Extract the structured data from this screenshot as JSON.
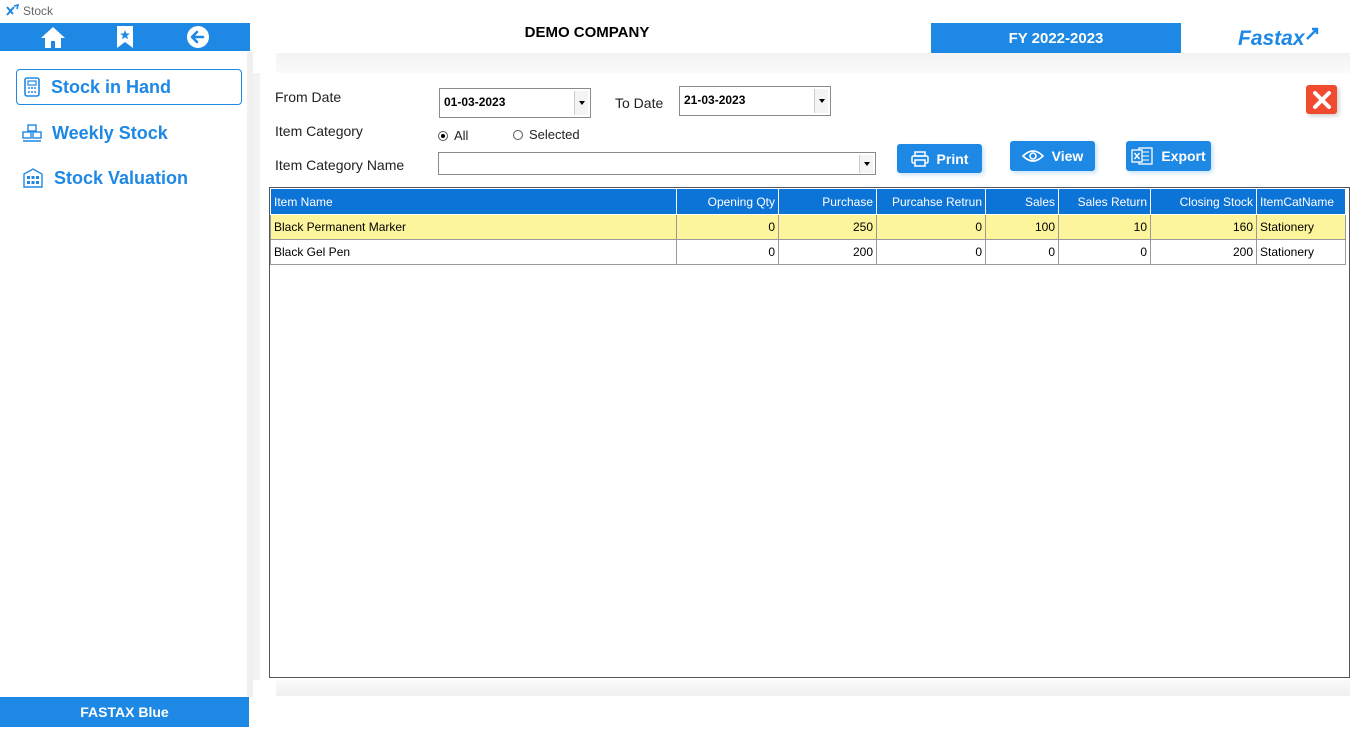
{
  "window": {
    "title": "Stock"
  },
  "header": {
    "company": "DEMO COMPANY",
    "fiscal_year": "FY 2022-2023",
    "brand": "Fastax"
  },
  "sidebar": {
    "items": [
      {
        "label": "Stock in Hand",
        "icon": "calculator-icon",
        "active": true
      },
      {
        "label": "Weekly Stock",
        "icon": "boxes-icon",
        "active": false
      },
      {
        "label": "Stock Valuation",
        "icon": "building-icon",
        "active": false
      }
    ],
    "footer": "FASTAX Blue"
  },
  "filters": {
    "from_date_label": "From Date",
    "from_date_value": "01-03-2023",
    "to_date_label": "To Date",
    "to_date_value": "21-03-2023",
    "category_label": "Item Category",
    "radio_all": "All",
    "radio_selected": "Selected",
    "category_name_label": "Item Category Name",
    "category_name_value": ""
  },
  "buttons": {
    "print": "Print",
    "view": "View",
    "export": "Export"
  },
  "grid": {
    "columns": [
      "Item Name",
      "Opening Qty",
      "Purchase",
      "Purcahse Retrun",
      "Sales",
      "Sales Return",
      "Closing Stock",
      "ItemCatName"
    ],
    "rows": [
      [
        "Black Permanent Marker",
        "0",
        "250",
        "0",
        "100",
        "10",
        "160",
        "Stationery"
      ],
      [
        "Black Gel Pen",
        "0",
        "200",
        "0",
        "0",
        "0",
        "200",
        "Stationery"
      ]
    ]
  },
  "colors": {
    "accent": "#1e88e5",
    "header": "#0c74d6",
    "highlight": "#fdf59c",
    "close": "#f04a2f"
  }
}
